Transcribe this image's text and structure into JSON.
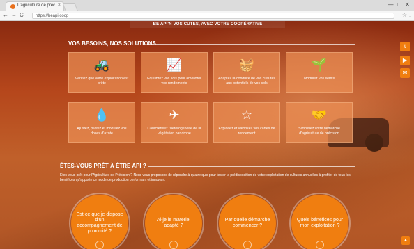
{
  "browser": {
    "tab_title": "L'agriculture de précision",
    "tab_close": "×",
    "window_controls": [
      "—",
      "□",
      "✕"
    ],
    "back": "←",
    "forward": "→",
    "reload": "C",
    "url": "https://beapi.coop",
    "bookmark_icon": "star-icon",
    "menu_icon": "menu-icon"
  },
  "header": {
    "banner_text": "BE API'N VOS CUTES, AVEC VOTRE COOPÉRATIVE"
  },
  "needs": {
    "title": "VOS BESOINS, NOS SOLUTIONS",
    "cards": [
      {
        "icon": "tractor-icon",
        "glyph": "🚜",
        "label": "Vérifiez que votre exploitation est prête"
      },
      {
        "icon": "chart-up-icon",
        "glyph": "📈",
        "label": "Equilibrez vos sols pour améliorer vos rendements"
      },
      {
        "icon": "bag-icon",
        "glyph": "🧺",
        "label": "Adaptez la conduite de vos cultures aux potentiels de vos sols"
      },
      {
        "icon": "seed-icon",
        "glyph": "🌱",
        "label": "Modulez vos semis"
      },
      {
        "icon": "sprayer-icon",
        "glyph": "💧",
        "label": "Ajustez, pilotez et modulez vos doses d'azote"
      },
      {
        "icon": "drone-icon",
        "glyph": "✈",
        "label": "Caractérisez l'hétérogénéité de la végétation par drone"
      },
      {
        "icon": "star-map-icon",
        "glyph": "☆",
        "label": "Exploitez et valorisez vos cartes de rendement"
      },
      {
        "icon": "handshake-icon",
        "glyph": "🤝",
        "label": "Simplifiez votre démarche d'agriculture de précision"
      }
    ]
  },
  "ready": {
    "title": "ÊTES-VOUS PRÊT À ÊTRE API ?",
    "description": "Etes-vous prêt pour l'Agriculture de Précision ? Nous vous proposons de répondre à quatre quis pour tester la prédisposition de votre exploitation de cultures annuelles à profiter de tous les bénéfices qu'apporte ce mode de production performant et innovant.",
    "circles": [
      {
        "label": "Est-ce que je dispose d'un accompagnement de proximité ?"
      },
      {
        "label": "Ai-je le matériel adapté ?"
      },
      {
        "label": "Par quelle démarche commencer ?"
      },
      {
        "label": "Quels bénéfices pour mon exploitation ?"
      }
    ]
  },
  "social": {
    "twitter": "twitter-icon",
    "youtube": "youtube-icon",
    "email": "email-icon"
  },
  "colors": {
    "accent": "#f07e10",
    "card": "#ec8f54"
  }
}
